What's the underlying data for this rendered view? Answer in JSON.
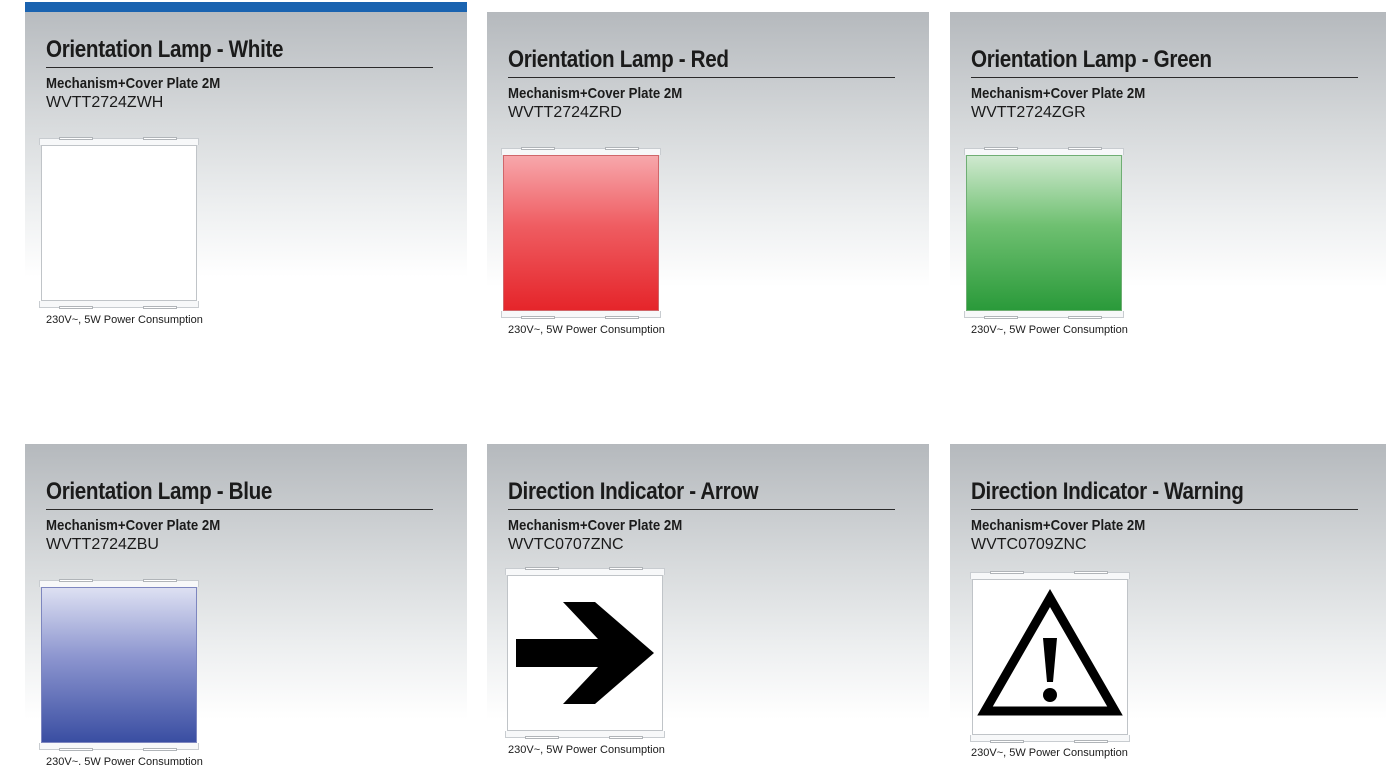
{
  "products": [
    {
      "title": "Orientation Lamp - White",
      "subtitle": "Mechanism+Cover Plate 2M",
      "code": "WVTT2724ZWH",
      "note": "230V~, 5W Power Consumption",
      "face": "white"
    },
    {
      "title": "Orientation Lamp - Red",
      "subtitle": "Mechanism+Cover Plate 2M",
      "code": "WVTT2724ZRD",
      "note": "230V~, 5W Power Consumption",
      "face": "red"
    },
    {
      "title": "Orientation Lamp - Green",
      "subtitle": "Mechanism+Cover Plate 2M",
      "code": "WVTT2724ZGR",
      "note": "230V~, 5W Power Consumption",
      "face": "green"
    },
    {
      "title": "Orientation Lamp - Blue",
      "subtitle": "Mechanism+Cover Plate 2M",
      "code": "WVTT2724ZBU",
      "note": "230V~, 5W Power Consumption",
      "face": "blue"
    },
    {
      "title": "Direction Indicator - Arrow",
      "subtitle": "Mechanism+Cover Plate 2M",
      "code": "WVTC0707ZNC",
      "note": "230V~, 5W Power Consumption",
      "face": "arrow-icon"
    },
    {
      "title": "Direction Indicator - Warning",
      "subtitle": "Mechanism+Cover Plate 2M",
      "code": "WVTC0709ZNC",
      "note": "230V~, 5W Power Consumption",
      "face": "warning-icon"
    }
  ],
  "colors": {
    "accent_bar": "#1a63b0",
    "red_lamp": "#e5252a",
    "green_lamp": "#2a9a3a",
    "blue_lamp": "#3a4ea2"
  }
}
